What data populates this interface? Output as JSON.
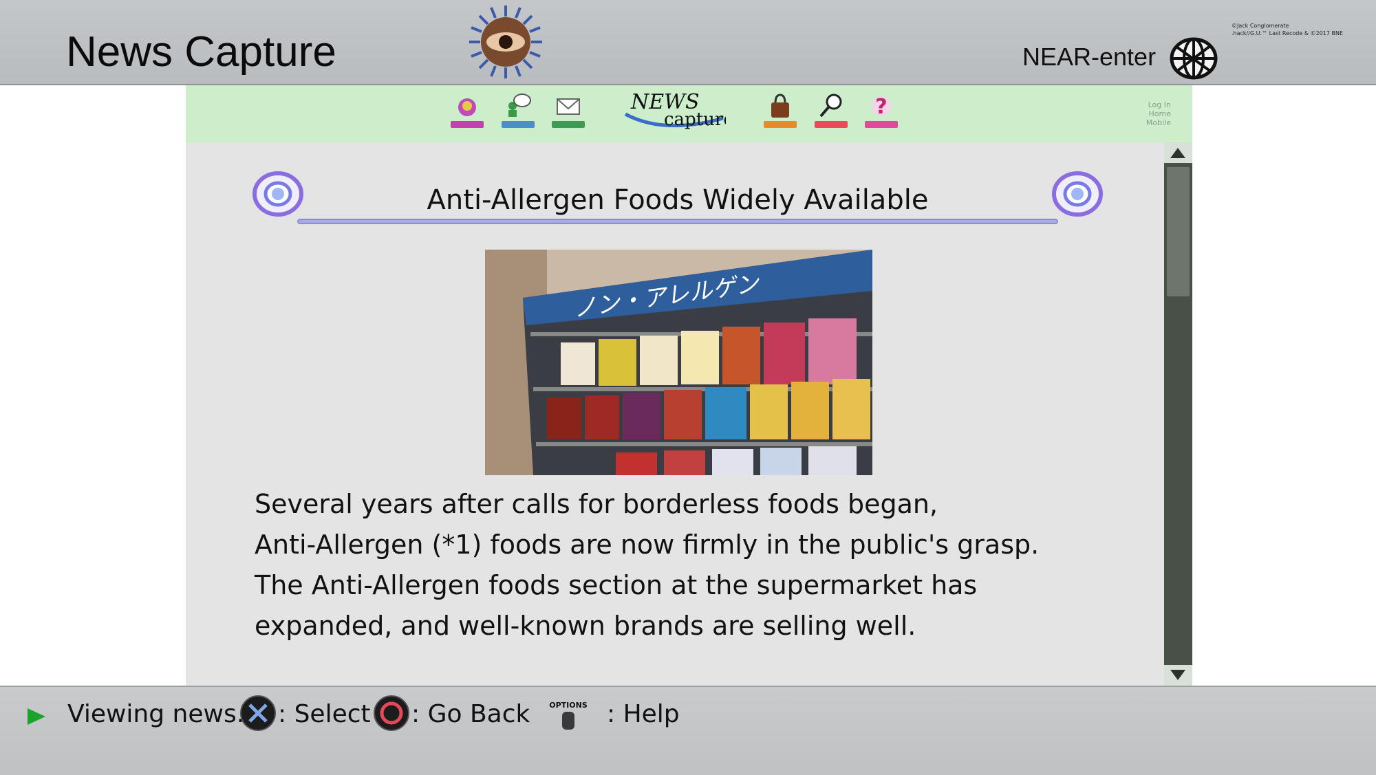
{
  "header": {
    "title": "News Capture",
    "near_label": "NEAR-enter",
    "copyright_line1": "©Jack Conglomerate",
    "copyright_line2": ".hack//G.U.™ Last Recode & ©2017 BNE"
  },
  "site": {
    "logo_text_1": "NEWS",
    "logo_text_2": "capture",
    "nav_icons": [
      "portal-icon",
      "community-icon",
      "mail-icon",
      "shop-icon",
      "search-icon",
      "help-icon"
    ],
    "links": [
      "Log In",
      "Home",
      "Mobile"
    ]
  },
  "article": {
    "headline": "Anti-Allergen Foods Widely Available",
    "image_sign_text": "ノン・アレルゲン",
    "body_lines": [
      "Several years after calls for borderless foods began,",
      "Anti-Allergen (*1) foods are now firmly in the public's grasp.",
      "The Anti-Allergen foods section at the supermarket has",
      "expanded, and well-known brands are selling well."
    ]
  },
  "footer": {
    "status": "Viewing news.",
    "select": ": Select",
    "go_back": ": Go Back",
    "options_label": "OPTIONS",
    "help": ": Help"
  },
  "colors": {
    "site_header_bg": "#cdeecb",
    "content_bg": "#e4e4e4",
    "accent_ring": "#8a6ee0",
    "status_arrow": "#1aa32b"
  }
}
